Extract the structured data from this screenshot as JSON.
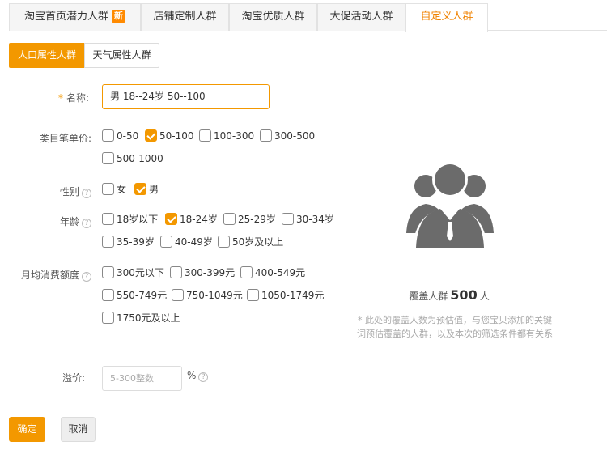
{
  "tabs": [
    {
      "label": "淘宝首页潜力人群",
      "badge": "新"
    },
    {
      "label": "店铺定制人群"
    },
    {
      "label": "淘宝优质人群"
    },
    {
      "label": "大促活动人群"
    },
    {
      "label": "自定义人群"
    }
  ],
  "sub_tabs": [
    "人口属性人群",
    "天气属性人群"
  ],
  "form": {
    "name": {
      "required_mark": "*",
      "label": "名称:",
      "value": "男  18--24岁  50--100"
    },
    "price": {
      "label": "类目笔单价:",
      "options": [
        {
          "label": "0-50",
          "checked": false
        },
        {
          "label": "50-100",
          "checked": true
        },
        {
          "label": "100-300",
          "checked": false
        },
        {
          "label": "300-500",
          "checked": false
        },
        {
          "label": "500-1000",
          "checked": false
        }
      ]
    },
    "gender": {
      "label": "性别",
      "options": [
        {
          "label": "女",
          "checked": false
        },
        {
          "label": "男",
          "checked": true
        }
      ]
    },
    "age": {
      "label": "年龄",
      "options": [
        {
          "label": "18岁以下",
          "checked": false
        },
        {
          "label": "18-24岁",
          "checked": true
        },
        {
          "label": "25-29岁",
          "checked": false
        },
        {
          "label": "30-34岁",
          "checked": false
        },
        {
          "label": "35-39岁",
          "checked": false
        },
        {
          "label": "40-49岁",
          "checked": false
        },
        {
          "label": "50岁及以上",
          "checked": false
        }
      ]
    },
    "spending": {
      "label": "月均消费额度",
      "options": [
        {
          "label": "300元以下",
          "checked": false
        },
        {
          "label": "300-399元",
          "checked": false
        },
        {
          "label": "400-549元",
          "checked": false
        },
        {
          "label": "550-749元",
          "checked": false
        },
        {
          "label": "750-1049元",
          "checked": false
        },
        {
          "label": "1050-1749元",
          "checked": false
        },
        {
          "label": "1750元及以上",
          "checked": false
        }
      ]
    },
    "premium": {
      "label": "溢价:",
      "placeholder": "5-300整数",
      "unit": "%"
    },
    "help_glyph": "?"
  },
  "buttons": {
    "confirm": "确定",
    "cancel": "取消"
  },
  "coverage": {
    "prefix": "覆盖人群",
    "count": "500",
    "suffix": "人",
    "note": "* 此处的覆盖人数为预估值，与您宝贝添加的关键词预估覆盖的人群，以及本次的筛选条件都有关系"
  },
  "colors": {
    "accent": "#f39800",
    "tab_active_text": "#f08200",
    "icon_gray": "#6b6b6b"
  },
  "icons": {
    "audience": "people-group-icon",
    "help": "question-circle-icon"
  }
}
